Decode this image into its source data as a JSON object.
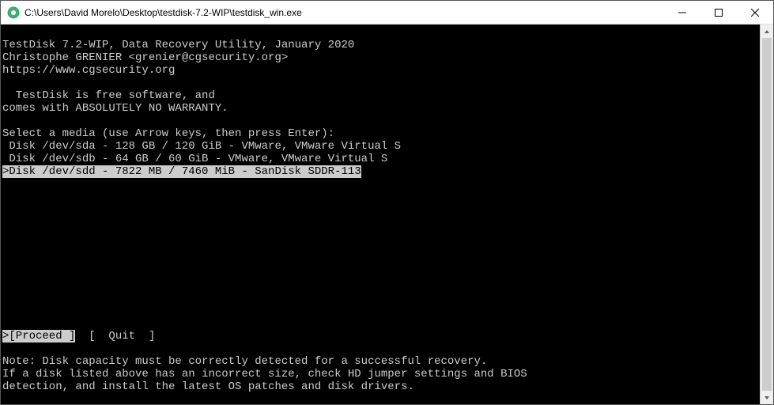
{
  "window": {
    "title": "C:\\Users\\David Morelo\\Desktop\\testdisk-7.2-WIP\\testdisk_win.exe"
  },
  "header": {
    "line1": "TestDisk 7.2-WIP, Data Recovery Utility, January 2020",
    "line2": "Christophe GRENIER <grenier@cgsecurity.org>",
    "line3": "https://www.cgsecurity.org"
  },
  "about": {
    "line1": "  TestDisk is free software, and",
    "line2": "comes with ABSOLUTELY NO WARRANTY."
  },
  "prompt": "Select a media (use Arrow keys, then press Enter):",
  "disks": [
    " Disk /dev/sda - 128 GB / 120 GiB - VMware, VMware Virtual S",
    " Disk /dev/sdb - 64 GB / 60 GiB - VMware, VMware Virtual S",
    ">Disk /dev/sdd - 7822 MB / 7460 MiB - SanDisk SDDR-113"
  ],
  "menu": {
    "proceed": ">[Proceed ]",
    "quit": "  [  Quit  ]"
  },
  "note": {
    "line1": "Note: Disk capacity must be correctly detected for a successful recovery.",
    "line2": "If a disk listed above has an incorrect size, check HD jumper settings and BIOS",
    "line3": "detection, and install the latest OS patches and disk drivers."
  }
}
